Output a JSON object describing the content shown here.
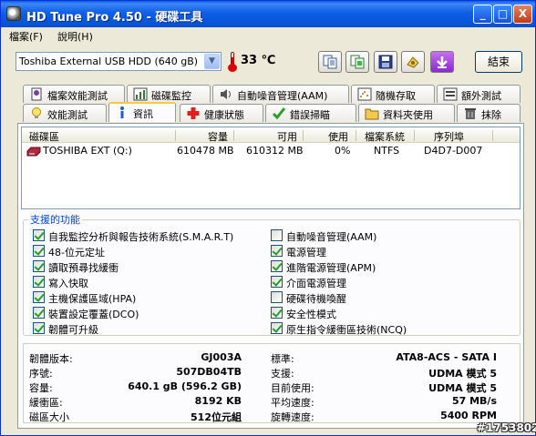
{
  "window": {
    "title": "HD Tune Pro 4.50 - 硬碟工具",
    "min_glyph": "_",
    "max_glyph": "□",
    "close_glyph": "X"
  },
  "menu": [
    "檔案(F)",
    "說明(H)"
  ],
  "toolbar": {
    "drive": "Toshiba External USB HDD (640 gB)",
    "temperature": "33 ℃",
    "exit_label": "結束",
    "icon_buttons": [
      "copy-text-icon",
      "copy-screen-icon",
      "save-icon",
      "options-icon",
      "download-icon"
    ]
  },
  "tabs_row1": [
    {
      "label": "檔案效能測試",
      "icon": "file-benchmark-icon"
    },
    {
      "label": "磁碟監控",
      "icon": "disk-monitor-icon"
    },
    {
      "label": "自動噪音管理(AAM)",
      "icon": "speaker-icon"
    },
    {
      "label": "隨機存取",
      "icon": "random-access-icon"
    },
    {
      "label": "額外測試",
      "icon": "extra-tests-icon"
    }
  ],
  "tabs_row2": [
    {
      "label": "效能測試",
      "icon": "lightbulb-icon"
    },
    {
      "label": "資訊",
      "icon": "info-icon",
      "active": true
    },
    {
      "label": "健康狀態",
      "icon": "health-cross-icon"
    },
    {
      "label": "錯誤掃瞄",
      "icon": "error-scan-icon"
    },
    {
      "label": "資料夾使用",
      "icon": "folder-icon"
    },
    {
      "label": "抹除",
      "icon": "trash-icon"
    }
  ],
  "list": {
    "headers": [
      "磁碟區",
      "容量",
      "可用",
      "使用",
      "檔案系統",
      "序列埠"
    ],
    "rows": [
      {
        "volume": "TOSHIBA EXT (Q:)",
        "capacity": "610478 MB",
        "free": "610312 MB",
        "usage": "0%",
        "fs": "NTFS",
        "serial": "D4D7-D007"
      }
    ]
  },
  "features": {
    "title": "支援的功能",
    "left": [
      {
        "label": "自我監控分析與報告技術系統(S.M.A.R.T)",
        "checked": true
      },
      {
        "label": "48-位元定址",
        "checked": true
      },
      {
        "label": "讀取預尋找緩衝",
        "checked": true
      },
      {
        "label": "寫入快取",
        "checked": true
      },
      {
        "label": "主機保護區域(HPA)",
        "checked": true
      },
      {
        "label": "裝置設定覆蓋(DCO)",
        "checked": true
      },
      {
        "label": "韌體可升級",
        "checked": true
      }
    ],
    "right": [
      {
        "label": "自動噪音管理(AAM)",
        "checked": false
      },
      {
        "label": "電源管理",
        "checked": true
      },
      {
        "label": "進階電源管理(APM)",
        "checked": true
      },
      {
        "label": "介面電源管理",
        "checked": true
      },
      {
        "label": "硬碟待機喚醒",
        "checked": false
      },
      {
        "label": "安全性模式",
        "checked": true
      },
      {
        "label": "原生指令緩衝區技術(NCQ)",
        "checked": true
      }
    ]
  },
  "info": {
    "left": [
      {
        "label": "韌體版本:",
        "value": "GJ003A"
      },
      {
        "label": "序號:",
        "value": "507DB04TB"
      },
      {
        "label": "容量:",
        "value": "640.1 gB (596.2 GB)"
      },
      {
        "label": "緩衝區:",
        "value": "8192 KB"
      },
      {
        "label": "磁區大小",
        "value": "512位元組"
      }
    ],
    "right": [
      {
        "label": "標準:",
        "value": "ATA8-ACS - SATA I"
      },
      {
        "label": "支援:",
        "value": "UDMA 模式 5"
      },
      {
        "label": "目前使用:",
        "value": "UDMA 模式 5"
      },
      {
        "label": "平均速度:",
        "value": "57 MB/s"
      },
      {
        "label": "旋轉速度:",
        "value": "5400 RPM"
      }
    ]
  },
  "watermark": "#1753802"
}
